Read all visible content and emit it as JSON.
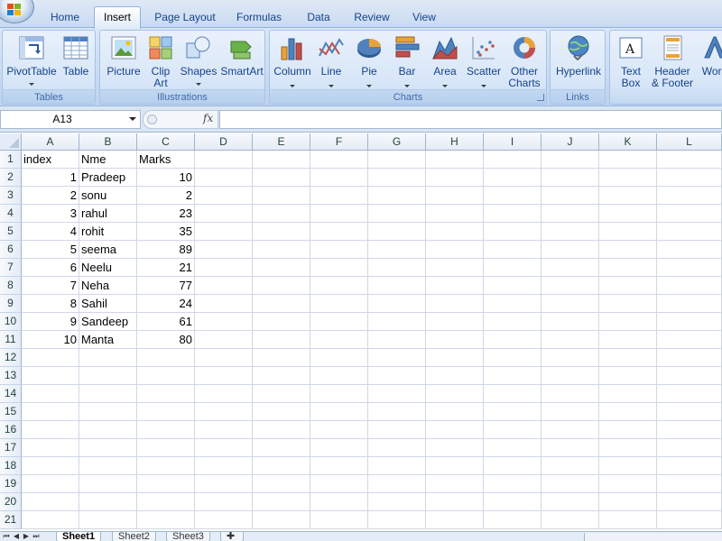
{
  "ribbon_tabs": [
    {
      "label": "Home"
    },
    {
      "label": "Insert",
      "active": true
    },
    {
      "label": "Page Layout"
    },
    {
      "label": "Formulas"
    },
    {
      "label": "Data"
    },
    {
      "label": "Review"
    },
    {
      "label": "View"
    }
  ],
  "groups": {
    "tables": {
      "label": "Tables",
      "pivottable": "PivotTable",
      "table": "Table"
    },
    "illustrations": {
      "label": "Illustrations",
      "picture": "Picture",
      "clipart": "Clip\nArt",
      "shapes": "Shapes",
      "smartart": "SmartArt"
    },
    "charts": {
      "label": "Charts",
      "column": "Column",
      "line": "Line",
      "pie": "Pie",
      "bar": "Bar",
      "area": "Area",
      "scatter": "Scatter",
      "other": "Other\nCharts"
    },
    "links": {
      "label": "Links",
      "hyperlink": "Hyperlink"
    },
    "text": {
      "textbox": "Text\nBox",
      "headerfooter": "Header\n& Footer",
      "wordart": "Word"
    }
  },
  "formula_bar": {
    "name_box": "A13",
    "fx": "fx",
    "formula": ""
  },
  "sheet": {
    "columns": [
      "A",
      "B",
      "C",
      "D",
      "E",
      "F",
      "G",
      "H",
      "I",
      "J",
      "K",
      "L"
    ],
    "rows": [
      "1",
      "2",
      "3",
      "4",
      "5",
      "6",
      "7",
      "8",
      "9",
      "10",
      "11",
      "12",
      "13",
      "14",
      "15",
      "16",
      "17",
      "18",
      "19",
      "20",
      "21"
    ],
    "cells": [
      [
        "index",
        "Nme",
        "Marks"
      ],
      [
        "1",
        "Pradeep",
        "10"
      ],
      [
        "2",
        "sonu",
        "2"
      ],
      [
        "3",
        "rahul",
        "23"
      ],
      [
        "4",
        "rohit",
        "35"
      ],
      [
        "5",
        "seema",
        "89"
      ],
      [
        "6",
        "Neelu",
        "21"
      ],
      [
        "7",
        "Neha",
        "77"
      ],
      [
        "8",
        "Sahil",
        "24"
      ],
      [
        "9",
        "Sandeep",
        "61"
      ],
      [
        "10",
        "Manta",
        "80"
      ]
    ]
  },
  "sheet_tabs": [
    {
      "label": "Sheet1",
      "active": true
    },
    {
      "label": "Sheet2"
    },
    {
      "label": "Sheet3"
    }
  ],
  "colors": {
    "ribbon_text": "#15428b",
    "grid_line": "#d0d7e5",
    "header_border": "#9eb6ce"
  }
}
